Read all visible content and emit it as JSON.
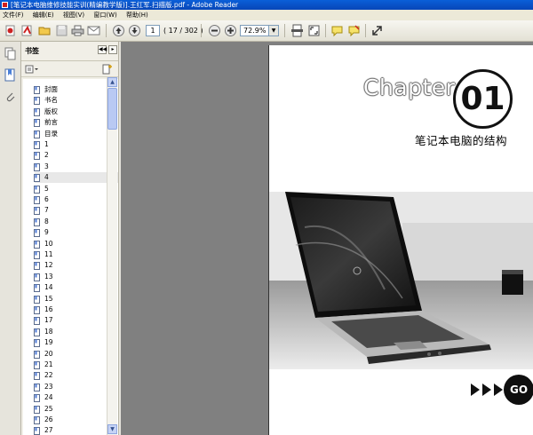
{
  "window": {
    "title": "[笔记本电脑维修技能实训(精编教学版)].王红军.扫描版.pdf - Adobe Reader"
  },
  "menu": [
    "文件(F)",
    "编辑(E)",
    "视图(V)",
    "窗口(W)",
    "帮助(H)"
  ],
  "toolbar": {
    "page_number": "1",
    "page_count": "( 17 / 302 )",
    "zoom": "72.9%"
  },
  "panel": {
    "title": "书签",
    "bookmarks": [
      "封面",
      "书名",
      "版权",
      "前言",
      "目录",
      "1",
      "2",
      "3",
      "4",
      "5",
      "6",
      "7",
      "8",
      "9",
      "10",
      "11",
      "12",
      "13",
      "14",
      "15",
      "16",
      "17",
      "18",
      "19",
      "20",
      "21",
      "22",
      "23",
      "24",
      "25",
      "26",
      "27"
    ],
    "selected_index": 5
  },
  "document": {
    "chapter_word": "Chapter",
    "chapter_number": "01",
    "subtitle": "笔记本电脑的结构",
    "go_label": "GO"
  }
}
